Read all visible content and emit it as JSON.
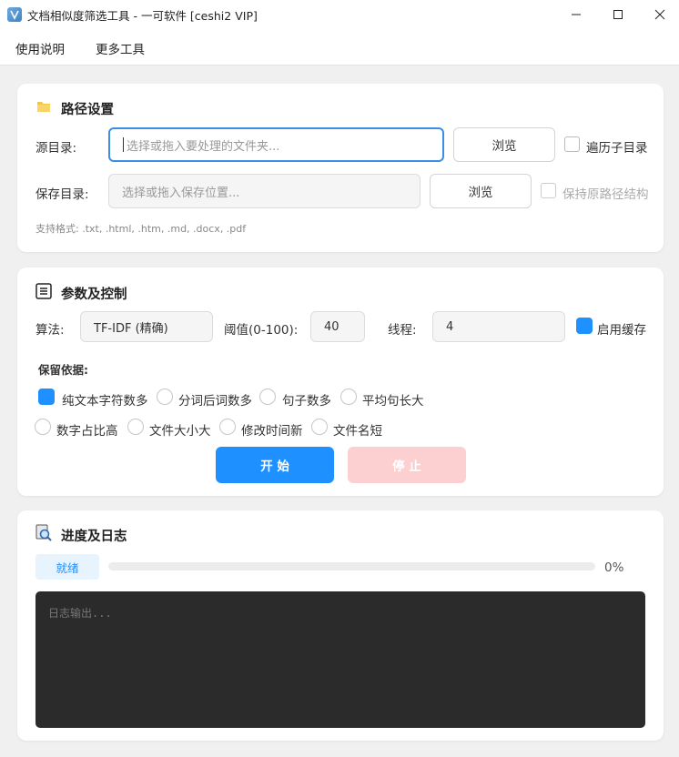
{
  "window": {
    "title": "文档相似度筛选工具 - 一可软件 [ceshi2 VIP]"
  },
  "menu": [
    "使用说明",
    "更多工具"
  ],
  "path_section": {
    "title": "路径设置",
    "source_label": "源目录:",
    "source_placeholder": "选择或拖入要处理的文件夹...",
    "browse_label": "浏览",
    "recursive_label": "遍历子目录",
    "save_label": "保存目录:",
    "save_placeholder": "选择或拖入保存位置...",
    "keep_structure_label": "保持原路径结构",
    "formats_note": "支持格式: .txt, .html, .htm, .md, .docx, .pdf"
  },
  "params_section": {
    "title": "参数及控制",
    "algo_label": "算法:",
    "algo_value": "TF-IDF (精确)",
    "threshold_label": "阈值(0-100):",
    "threshold_value": "40",
    "threads_label": "线程:",
    "threads_value": "4",
    "cache_label": "启用缓存",
    "retain_label": "保留依据:",
    "options_row1": [
      "纯文本字符数多",
      "分词后词数多",
      "句子数多",
      "平均句长大"
    ],
    "options_row2": [
      "数字占比高",
      "文件大小大",
      "修改时间新",
      "文件名短"
    ],
    "start_label": "开 始",
    "stop_label": "停 止"
  },
  "log_section": {
    "title": "进度及日志",
    "status": "就绪",
    "progress_percent": "0%",
    "progress": 0,
    "log_placeholder": "日志输出..."
  },
  "colors": {
    "accent": "#1e90ff",
    "stop_disabled": "#fcd0d0",
    "log_bg": "#2b2b2b"
  }
}
